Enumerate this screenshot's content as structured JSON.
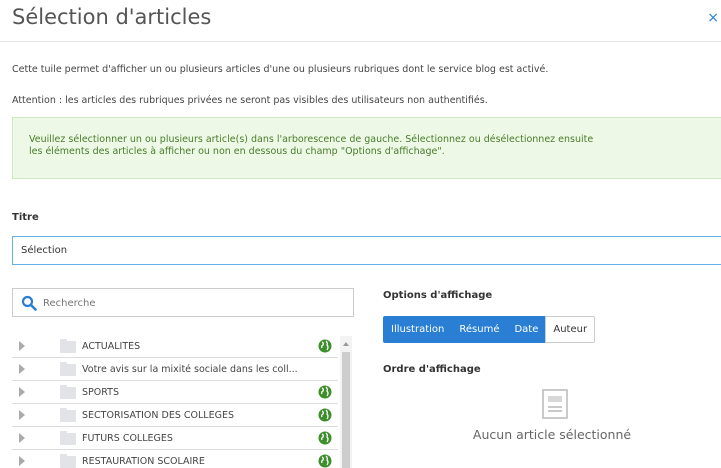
{
  "header": {
    "title": "Sélection d'articles",
    "close_label": "×"
  },
  "intro": {
    "text1": "Cette tuile permet d'afficher un ou plusieurs articles d'une ou plusieurs rubriques dont le service blog est activé.",
    "text2": "Attention : les articles des rubriques privées ne seront pas visibles des utilisateurs non authentifiés."
  },
  "alert": {
    "line1": "Veuillez sélectionner un ou plusieurs article(s) dans l'arborescence de gauche. Sélectionnez ou désélectionnez ensuite",
    "line2": "les éléments des articles à afficher ou non en dessous du champ \"Options d'affichage\"."
  },
  "titre": {
    "label": "Titre",
    "value": "Sélection"
  },
  "search": {
    "placeholder": "Recherche"
  },
  "tree": {
    "items": [
      {
        "label": "ACTUALITÉS",
        "globe": true
      },
      {
        "label": "Votre avis sur la mixité sociale dans les coll...",
        "globe": false
      },
      {
        "label": "SPORTS",
        "globe": true
      },
      {
        "label": "SECTORISATION DES COLLÈGES",
        "globe": true
      },
      {
        "label": "FUTURS COLLÈGES",
        "globe": true
      },
      {
        "label": "RESTAURATION SCOLAIRE",
        "globe": true
      }
    ]
  },
  "options": {
    "label": "Options d'affichage",
    "buttons": [
      "Illustration",
      "Résumé",
      "Date",
      "Auteur"
    ]
  },
  "order": {
    "label": "Ordre d'affichage",
    "empty_message": "Aucun article sélectionné"
  },
  "colors": {
    "accent": "#2a7fd4",
    "alert_bg": "#edf8e7",
    "alert_text": "#4a7c2a",
    "globe": "#3c8f2a"
  }
}
